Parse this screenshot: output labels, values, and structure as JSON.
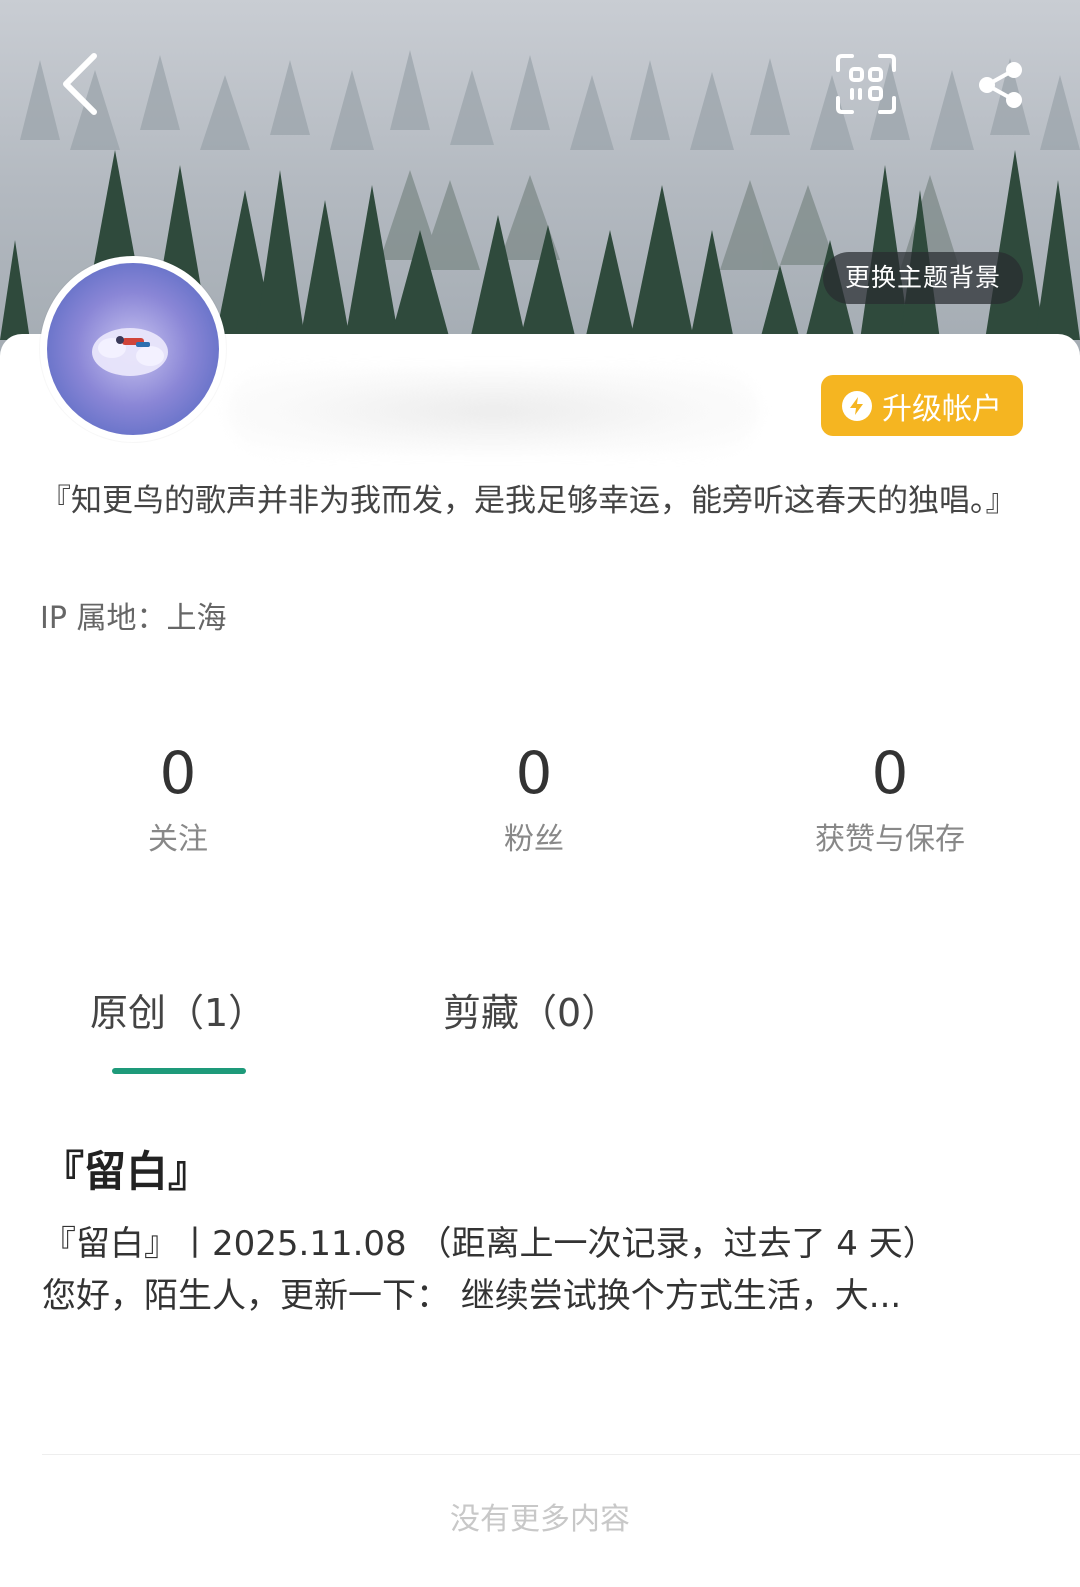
{
  "header": {
    "back_icon": "chevron-left-icon",
    "scan_icon": "qr-scan-icon",
    "share_icon": "share-icon",
    "theme_button_label": "更换主题背景"
  },
  "profile": {
    "upgrade_label": "升级帐户",
    "upgrade_icon": "lightning-icon",
    "bio": "『知更鸟的歌声并非为我而发，是我足够幸运，能旁听这春天的独唱。』",
    "ip_location": "IP 属地：上海"
  },
  "stats": [
    {
      "value": "0",
      "label": "关注"
    },
    {
      "value": "0",
      "label": "粉丝"
    },
    {
      "value": "0",
      "label": "获赞与保存"
    }
  ],
  "tabs": [
    {
      "label": "原创（1）",
      "active": true
    },
    {
      "label": "剪藏（0）",
      "active": false
    }
  ],
  "post": {
    "title": "『留白』",
    "excerpt_line1": "『留白』丨2025.11.08 （距离上一次记录，过去了 4 天）",
    "excerpt_line2": "您好，陌生人，更新一下： 继续尝试换个方式生活，大..."
  },
  "footer": {
    "no_more_text": "没有更多内容"
  },
  "colors": {
    "accent": "#1e9a7a",
    "upgrade": "#f5b521"
  }
}
